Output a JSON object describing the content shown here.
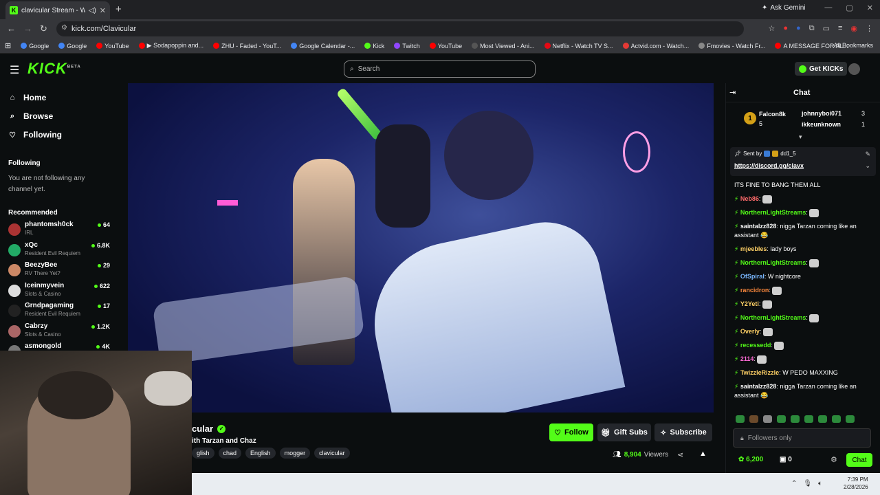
{
  "browser": {
    "tab_title": "clavicular Stream - Watch L",
    "new_tab": "+",
    "ask_gemini": "Ask Gemini",
    "url": "kick.com/Clavicular",
    "bookmarks": [
      {
        "label": "Google",
        "color": "#4285f4"
      },
      {
        "label": "Google",
        "color": "#4285f4"
      },
      {
        "label": "YouTube",
        "color": "#ff0000"
      },
      {
        "label": "▶ Sodapoppin and...",
        "color": "#ff0000"
      },
      {
        "label": "ZHU - Faded - YouT...",
        "color": "#ff0000"
      },
      {
        "label": "Google Calendar -...",
        "color": "#4285f4"
      },
      {
        "label": "Kick",
        "color": "#53fc18"
      },
      {
        "label": "Twitch",
        "color": "#9146ff"
      },
      {
        "label": "YouTube",
        "color": "#ff0000"
      },
      {
        "label": "Most Viewed - Ani...",
        "color": "#555555"
      },
      {
        "label": "Netflix - Watch TV S...",
        "color": "#e50914"
      },
      {
        "label": "Actvid.com - Watch...",
        "color": "#e53935"
      },
      {
        "label": "Fmovies - Watch Fr...",
        "color": "#888888"
      },
      {
        "label": "A MESSAGE FOR AL...",
        "color": "#ff0000"
      }
    ],
    "all_bookmarks": "All Bookmarks"
  },
  "kick": {
    "logo": "KICK",
    "logo_beta": "BETA",
    "search_placeholder": "Search",
    "get_kicks": "Get KICKs"
  },
  "sidebar": {
    "nav": [
      {
        "label": "Home",
        "icon": "⌂"
      },
      {
        "label": "Browse",
        "icon": "⌕"
      },
      {
        "label": "Following",
        "icon": "♡"
      }
    ],
    "following_header": "Following",
    "following_empty": "You are not following any channel yet.",
    "recommended_header": "Recommended",
    "recommended": [
      {
        "name": "phantomsh0ck",
        "category": "IRL",
        "viewers": "64",
        "color": "#a33"
      },
      {
        "name": "xQc",
        "category": "Resident Evil Requiem",
        "viewers": "6.8K",
        "color": "#2a6"
      },
      {
        "name": "BeezyBee",
        "category": "RV There Yet?",
        "viewers": "29",
        "color": "#c86"
      },
      {
        "name": "Iceinmyvein",
        "category": "Slots & Casino",
        "viewers": "622",
        "color": "#ddd"
      },
      {
        "name": "Grndpagaming",
        "category": "Resident Evil Requiem",
        "viewers": "17",
        "color": "#222"
      },
      {
        "name": "Cabrzy",
        "category": "Slots & Casino",
        "viewers": "1.2K",
        "color": "#a66"
      },
      {
        "name": "asmongold",
        "category": "",
        "viewers": "4K",
        "color": "#777"
      }
    ]
  },
  "stream": {
    "title": "cular",
    "subtitle": "ith Tarzan and Chaz",
    "tags": [
      "glish",
      "chad",
      "English",
      "mogger",
      "clavicular"
    ],
    "follow": "Follow",
    "gift_subs": "Gift Subs",
    "subscribe": "Subscribe",
    "viewers_count": "8,904",
    "viewers_label": "Viewers"
  },
  "chat": {
    "title": "Chat",
    "leaderboard": [
      {
        "name": "Falcon8k",
        "count": "5",
        "color": "#d4a017"
      },
      {
        "name": "johnnyboi071",
        "count": "3",
        "color": "#ffffff"
      },
      {
        "name": "ikkeunknown",
        "count": "1",
        "color": "#ff8a3d"
      }
    ],
    "medal_rank": "1",
    "pinned_sent_by": "Sent by",
    "pinned_user": "dd1_5",
    "pinned_link": "https://discord.gg/clavx",
    "messages": [
      {
        "user": "",
        "text": "ITS FINE TO BANG THEM ALL",
        "color": "#ffffff"
      },
      {
        "user": "Neb86",
        "text": "",
        "color": "#ff6b6b"
      },
      {
        "user": "NorthernLightStreams",
        "text": "",
        "color": "#53fc18"
      },
      {
        "user": "saintalzz828",
        "text": "nigga Tarzan coming like an assistant 😂",
        "color": "#ffffff"
      },
      {
        "user": "mjeebles",
        "text": "lady boys",
        "color": "#ffd166"
      },
      {
        "user": "NorthernLightStreams",
        "text": "",
        "color": "#53fc18"
      },
      {
        "user": "OfSpiral",
        "text": "W nightcore",
        "color": "#7ab8ff"
      },
      {
        "user": "rancidron",
        "text": "",
        "color": "#ff8a3d"
      },
      {
        "user": "Y2Yeti",
        "text": "",
        "color": "#ffd166"
      },
      {
        "user": "NorthernLightStreams",
        "text": "",
        "color": "#53fc18"
      },
      {
        "user": "Overly",
        "text": "",
        "color": "#ffd166"
      },
      {
        "user": "recessedd",
        "text": "",
        "color": "#53fc18"
      },
      {
        "user": "2114",
        "text": "",
        "color": "#ff6bd6"
      },
      {
        "user": "TwizzleRizzle",
        "text": "W PEDO MAXXING",
        "color": "#ffd166"
      },
      {
        "user": "saintalzz828",
        "text": "nigga Tarzan coming like an assistant 😂",
        "color": "#ffffff"
      }
    ],
    "input_placeholder": "Followers only",
    "kick_points": "6,200",
    "gift_count": "0",
    "send": "Chat"
  },
  "taskbar": {
    "time": "7:39 PM",
    "date": "2/28/2026"
  }
}
